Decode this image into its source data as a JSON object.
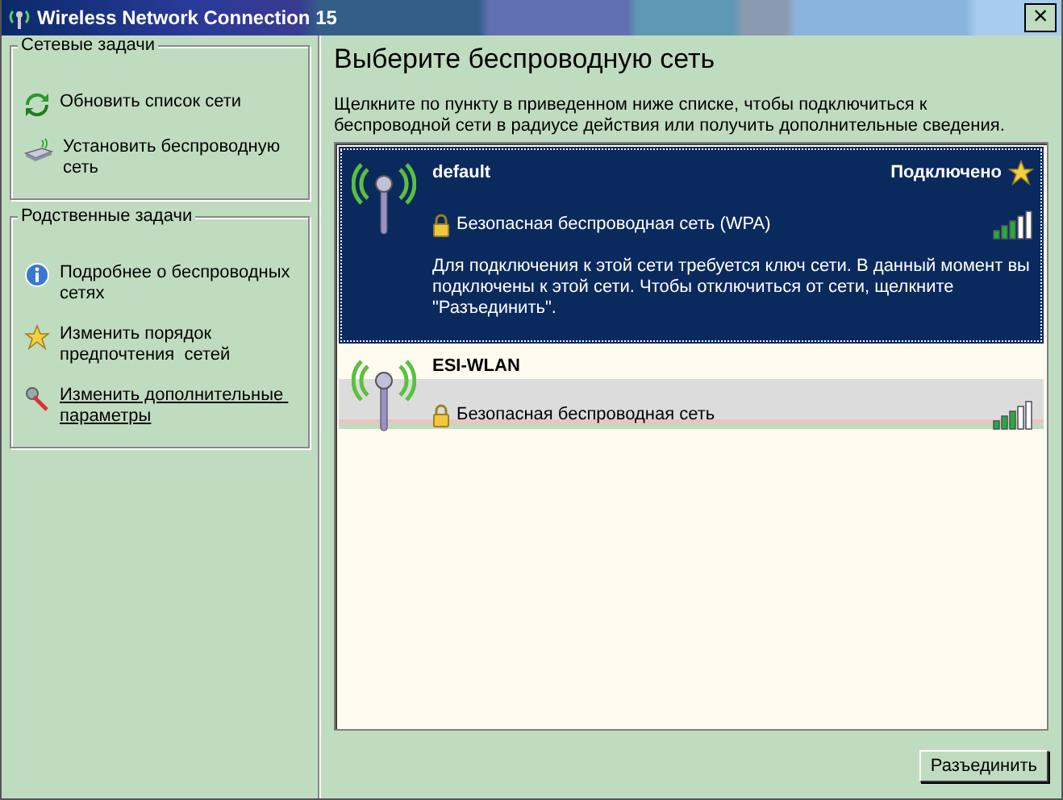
{
  "window": {
    "title": "Wireless Network Connection 15",
    "close": "×"
  },
  "sidebar": {
    "groups": [
      {
        "title": "Сетевые задачи",
        "items": [
          {
            "kind": "refresh",
            "label": "Обновить список сети",
            "hovered": false
          },
          {
            "kind": "router",
            "label": "Установить беспроводную сеть",
            "hovered": false
          }
        ]
      },
      {
        "title": "Родственные задачи",
        "items": [
          {
            "kind": "info",
            "label": "Подробнее о беспроводных сетях",
            "hovered": false
          },
          {
            "kind": "star",
            "label": "Изменить порядок предпочтения  сетей",
            "hovered": false
          },
          {
            "kind": "tools",
            "label": "Изменить дополнительные параметры",
            "hovered": true
          }
        ]
      }
    ]
  },
  "main": {
    "heading": "Выберите беспроводную сеть",
    "description": "Щелкните по пункту в приведенном ниже списке, чтобы подключиться к беспроводной сети в радиусе действия или получить дополнительные сведения.",
    "networks": [
      {
        "name": "default",
        "status": "Подключено",
        "security": "Безопасная беспроводная сеть (WPA)",
        "details": "Для подключения к этой сети требуется ключ сети. В данный момент вы подключены к этой сети. Чтобы отключиться от сети, щелкните \"Разъединить\".",
        "selected": true,
        "hovered": false
      },
      {
        "name": "ESI-WLAN",
        "security": "Безопасная беспроводная сеть",
        "selected": false,
        "hovered": true
      }
    ],
    "button": "Разъединить"
  }
}
